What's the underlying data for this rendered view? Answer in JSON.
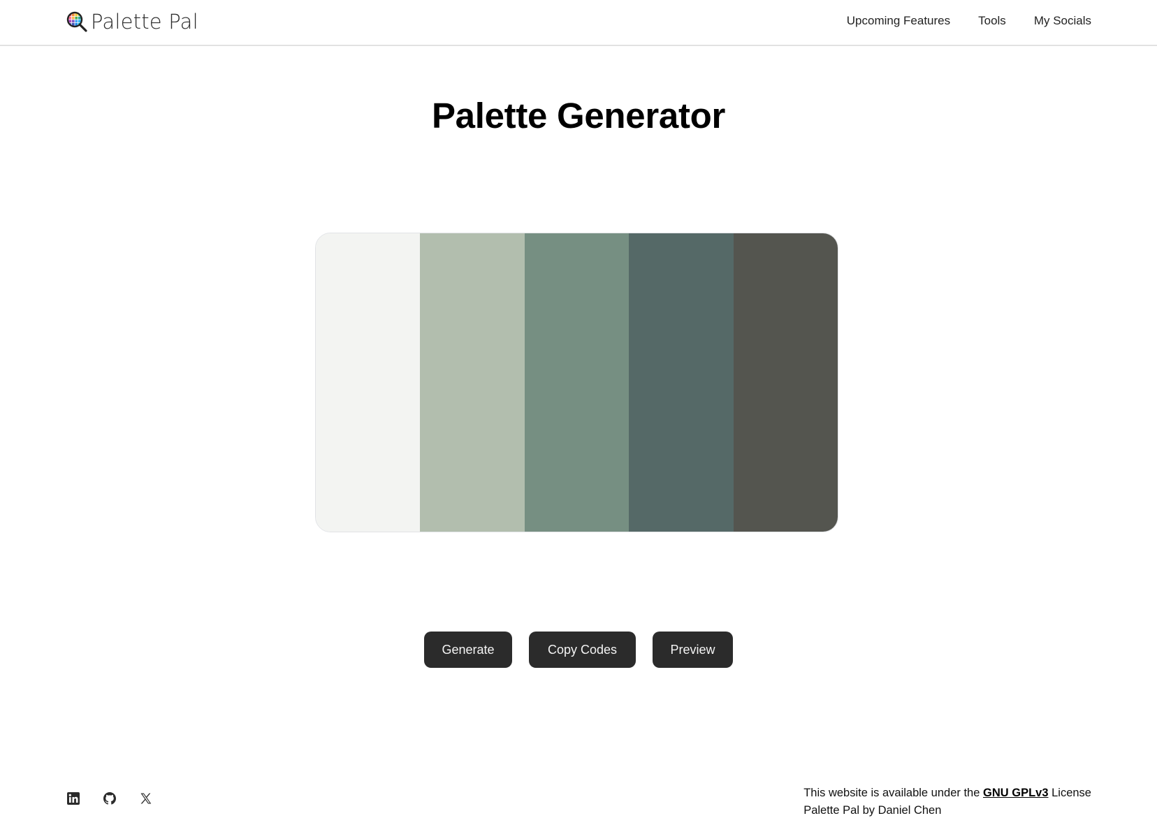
{
  "header": {
    "logo_text": "Palette Pal",
    "logo_icon": "magnifier-palette-icon",
    "nav": [
      {
        "label": "Upcoming Features"
      },
      {
        "label": "Tools"
      },
      {
        "label": "My Socials"
      }
    ]
  },
  "main": {
    "title": "Palette Generator",
    "palette": {
      "colors": [
        "#f3f4f2",
        "#b2beae",
        "#768f82",
        "#556967",
        "#54554f"
      ]
    },
    "buttons": {
      "generate": "Generate",
      "copy_codes": "Copy Codes",
      "preview": "Preview"
    }
  },
  "footer": {
    "socials": [
      {
        "name": "linkedin-icon"
      },
      {
        "name": "github-icon"
      },
      {
        "name": "x-icon"
      }
    ],
    "license_prefix": "This website is available under the ",
    "license_link": "GNU GPLv3",
    "license_suffix": " License",
    "credit": "Palette Pal by Daniel Chen"
  },
  "colors": {
    "button_bg": "#2b2b2b",
    "button_text": "#f4f4f4",
    "header_border": "#e2e2e2"
  }
}
